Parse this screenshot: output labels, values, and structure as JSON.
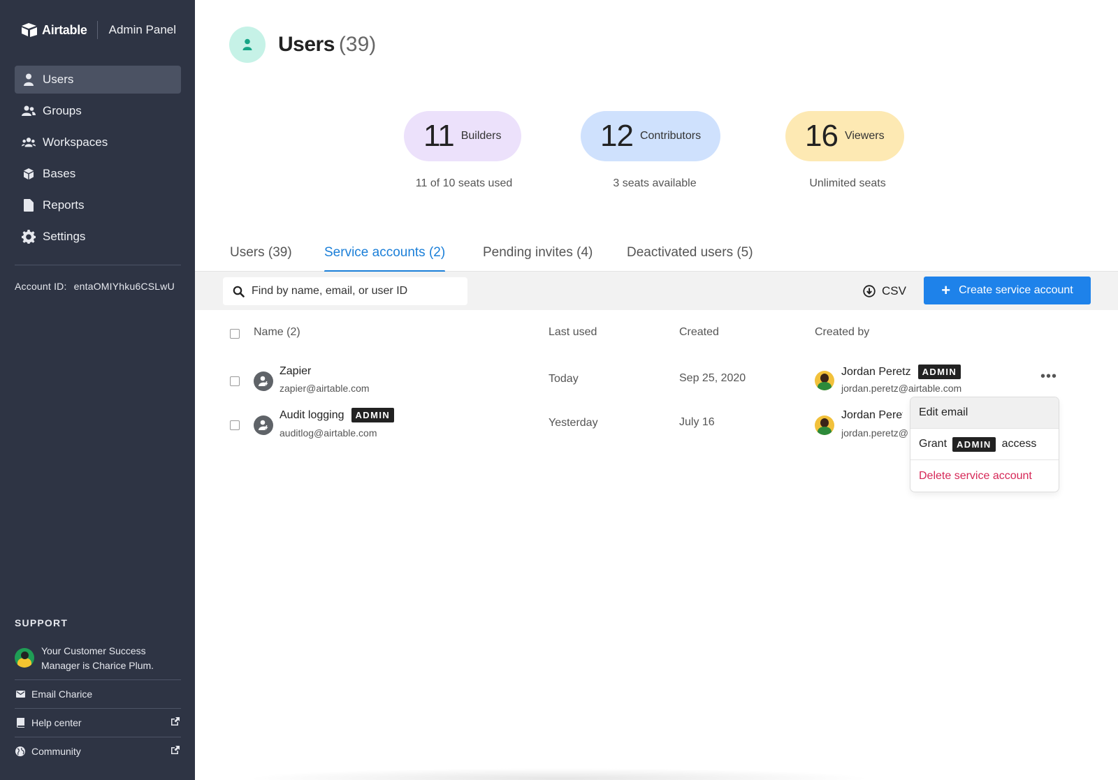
{
  "sidebar": {
    "brand_name": "Airtable",
    "panel_label": "Admin Panel",
    "nav": [
      {
        "label": "Users",
        "icon": "user-icon",
        "active": true
      },
      {
        "label": "Groups",
        "icon": "group-icon"
      },
      {
        "label": "Workspaces",
        "icon": "workspaces-icon"
      },
      {
        "label": "Bases",
        "icon": "cube-icon"
      },
      {
        "label": "Reports",
        "icon": "document-icon"
      },
      {
        "label": "Settings",
        "icon": "gear-icon"
      }
    ],
    "account_id_label": "Account ID:",
    "account_id_value": "entaOMIYhku6CSLwU",
    "support": {
      "title": "SUPPORT",
      "csm_text": "Your Customer Success Manager is Charice Plum.",
      "links": [
        {
          "label": "Email Charice",
          "icon": "mail-icon"
        },
        {
          "label": "Help center",
          "icon": "book-icon",
          "external": true
        },
        {
          "label": "Community",
          "icon": "globe-icon",
          "external": true
        }
      ]
    }
  },
  "header": {
    "title": "Users",
    "count": "(39)"
  },
  "stats": [
    {
      "number": "11",
      "label": "Builders",
      "caption": "11 of 10 seats used",
      "color": "#ece1fb"
    },
    {
      "number": "12",
      "label": "Contributors",
      "caption": "3 seats available",
      "color": "#cfe1fd"
    },
    {
      "number": "16",
      "label": "Viewers",
      "caption": "Unlimited seats",
      "color": "#fde9b3"
    }
  ],
  "tabs": [
    {
      "label": "Users (39)"
    },
    {
      "label": "Service accounts (2)",
      "active": true
    },
    {
      "label": "Pending invites (4)"
    },
    {
      "label": "Deactivated users (5)"
    }
  ],
  "toolbar": {
    "search_placeholder": "Find by name, email, or user ID",
    "csv_label": "CSV",
    "create_label": "Create service account",
    "create_color": "#1e82ea"
  },
  "table": {
    "headers": {
      "name": "Name (2)",
      "last_used": "Last used",
      "created": "Created",
      "created_by": "Created by"
    },
    "rows": [
      {
        "name": "Zapier",
        "email": "zapier@airtable.com",
        "admin": false,
        "last_used": "Today",
        "created": "Sep 25, 2020",
        "creator_name": "Jordan Peretz",
        "creator_admin": "ADMIN",
        "creator_email": "jordan.peretz@airtable.com"
      },
      {
        "name": "Audit logging",
        "admin_badge": "ADMIN",
        "email": "auditlog@airtable.com",
        "last_used": "Yesterday",
        "created": "July 16",
        "creator_name": "Jordan Peret",
        "creator_email": "jordan.peretz@"
      }
    ],
    "more_icon": "•••"
  },
  "context_menu": {
    "edit_email": "Edit email",
    "grant_prefix": "Grant",
    "grant_badge": "ADMIN",
    "grant_suffix": "access",
    "delete": "Delete service account",
    "danger_color": "#d62757"
  }
}
